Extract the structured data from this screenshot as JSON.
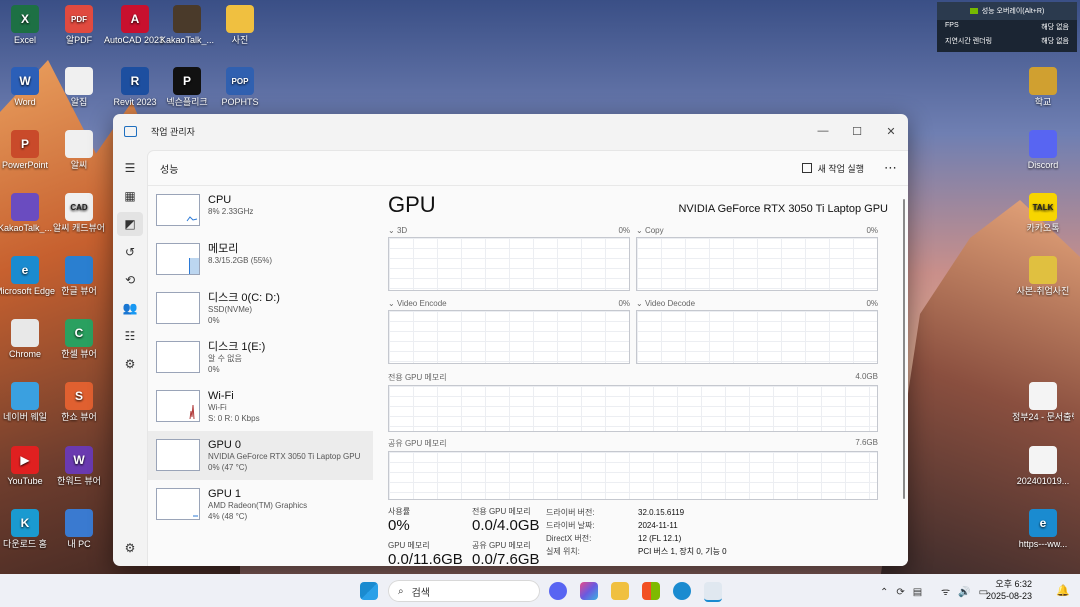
{
  "desktop": {
    "icons": [
      {
        "label": "Excel",
        "color": "#1d7044",
        "glyph": "X"
      },
      {
        "label": "알PDF",
        "color": "#e04a3f",
        "glyph": "PDF"
      },
      {
        "label": "AutoCAD 2023 - 한국...",
        "color": "#c8102e",
        "glyph": "A"
      },
      {
        "label": "KakaoTalk_...",
        "color": "#4a3a2a",
        "glyph": ""
      },
      {
        "label": "사진",
        "color": "#f0c040",
        "glyph": ""
      },
      {
        "label": "Word",
        "color": "#2b5fb8",
        "glyph": "W"
      },
      {
        "label": "알집",
        "color": "#f0f0f0",
        "glyph": ""
      },
      {
        "label": "Revit 2023",
        "color": "#1d4fa0",
        "glyph": "R"
      },
      {
        "label": "넥슨플리크",
        "color": "#111111",
        "glyph": "P"
      },
      {
        "label": "POPHTS",
        "color": "#3060b0",
        "glyph": "POP"
      },
      {
        "label": "PowerPoint",
        "color": "#c94a2a",
        "glyph": "P"
      },
      {
        "label": "알씨",
        "color": "#f0f0f0",
        "glyph": ""
      },
      {
        "label": "KakaoTalk_...",
        "color": "#6a4cc0",
        "glyph": ""
      },
      {
        "label": "알씨 캐드뷰어",
        "color": "#f0f0f0",
        "glyph": "CAD"
      },
      {
        "label": "Microsoft Edge",
        "color": "#1a8bd0",
        "glyph": "e"
      },
      {
        "label": "한글 뷰어",
        "color": "#2a7fd0",
        "glyph": ""
      },
      {
        "label": "Chrome",
        "color": "#e8e8e8",
        "glyph": ""
      },
      {
        "label": "한셀 뷰어",
        "color": "#2aa060",
        "glyph": "C"
      },
      {
        "label": "네이버 웨일",
        "color": "#3aa0e0",
        "glyph": ""
      },
      {
        "label": "한쇼 뷰어",
        "color": "#e06030",
        "glyph": "S"
      },
      {
        "label": "YouTube",
        "color": "#e02020",
        "glyph": "▶"
      },
      {
        "label": "한워드 뷰어",
        "color": "#6a3ab0",
        "glyph": "W"
      },
      {
        "label": "다운로드 홈",
        "color": "#1a9ad0",
        "glyph": "K"
      },
      {
        "label": "내 PC",
        "color": "#3a7ad0",
        "glyph": ""
      },
      {
        "label": "학교",
        "color": "#d0a030",
        "glyph": ""
      },
      {
        "label": "Discord",
        "color": "#5865f2",
        "glyph": ""
      },
      {
        "label": "카카오톡",
        "color": "#f7d500",
        "glyph": "TALK"
      },
      {
        "label": "사본-취업사진",
        "color": "#e0c040",
        "glyph": ""
      },
      {
        "label": "정부24 - 문서출력.pdf",
        "color": "#f4f4f4",
        "glyph": ""
      },
      {
        "label": "202401019...",
        "color": "#f4f4f4",
        "glyph": ""
      },
      {
        "label": "https---ww...",
        "color": "#1a8bd0",
        "glyph": "e"
      }
    ]
  },
  "overlay": {
    "header": "성능 오버레이(Alt+R)",
    "rows": [
      {
        "k": "FPS",
        "v": "해당 없음"
      },
      {
        "k": "지연시간 렌더링",
        "v": "해당 없음"
      }
    ]
  },
  "window": {
    "title": "작업 관리자",
    "page_title": "성능",
    "new_task": "새 작업 실행",
    "more": "⋯"
  },
  "sidebar": [
    {
      "name": "CPU",
      "sub1": "8% 2.33GHz",
      "sub2": ""
    },
    {
      "name": "메모리",
      "sub1": "8.3/15.2GB (55%)",
      "sub2": ""
    },
    {
      "name": "디스크 0(C: D:)",
      "sub1": "SSD(NVMe)",
      "sub2": "0%"
    },
    {
      "name": "디스크 1(E:)",
      "sub1": "알 수 없음",
      "sub2": "0%"
    },
    {
      "name": "Wi-Fi",
      "sub1": "Wi-Fi",
      "sub2": "S: 0 R: 0 Kbps"
    },
    {
      "name": "GPU 0",
      "sub1": "NVIDIA GeForce RTX 3050 Ti Laptop GPU",
      "sub2": "0% (47 °C)"
    },
    {
      "name": "GPU 1",
      "sub1": "AMD Radeon(TM) Graphics",
      "sub2": "4% (48 °C)"
    }
  ],
  "gpu": {
    "heading": "GPU",
    "model": "NVIDIA GeForce RTX 3050 Ti Laptop GPU",
    "engines": [
      {
        "label": "3D",
        "pct": "0%"
      },
      {
        "label": "Copy",
        "pct": "0%"
      },
      {
        "label": "Video Encode",
        "pct": "0%"
      },
      {
        "label": "Video Decode",
        "pct": "0%"
      }
    ],
    "dedicated_label": "전용 GPU 메모리",
    "dedicated_max": "4.0GB",
    "shared_label": "공유 GPU 메모리",
    "shared_max": "7.6GB",
    "stats": {
      "usage_label": "사용률",
      "usage_value": "0%",
      "ded_label": "전용 GPU 메모리",
      "ded_value": "0.0/4.0GB",
      "gpumem_label": "GPU 메모리",
      "gpumem_value": "0.0/11.6GB",
      "shared_label": "공유 GPU 메모리",
      "shared_value": "0.0/7.6GB"
    },
    "details": [
      {
        "k": "드라이버 버전:",
        "v": "32.0.15.6119"
      },
      {
        "k": "드라이버 날짜:",
        "v": "2024-11-11"
      },
      {
        "k": "DirectX 버전:",
        "v": "12 (FL 12.1)"
      },
      {
        "k": "실제 위치:",
        "v": "PCI 버스 1, 장치 0, 기능 0"
      }
    ]
  },
  "taskbar": {
    "search": "검색",
    "time": "오후 6:32",
    "date": "2025-08-23"
  }
}
